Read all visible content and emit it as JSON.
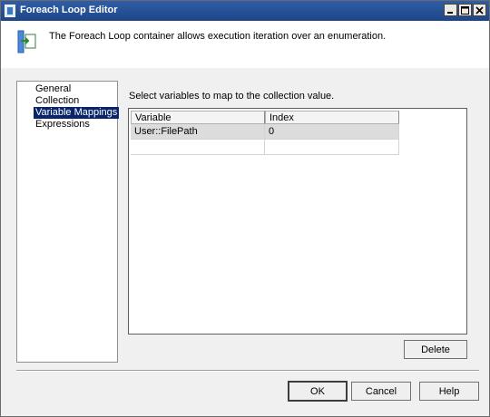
{
  "window": {
    "title": "Foreach Loop Editor",
    "description": "The Foreach Loop container allows execution iteration over an enumeration."
  },
  "sidebar": {
    "items": [
      {
        "label": "General",
        "selected": false
      },
      {
        "label": "Collection",
        "selected": false
      },
      {
        "label": "Variable Mappings",
        "selected": true
      },
      {
        "label": "Expressions",
        "selected": false
      }
    ]
  },
  "main": {
    "prompt": "Select variables to map to the collection value.",
    "columns": [
      "Variable",
      "Index"
    ],
    "rows": [
      {
        "variable": "User::FilePath",
        "index": "0"
      },
      {
        "variable": "",
        "index": ""
      }
    ],
    "delete_label": "Delete"
  },
  "footer": {
    "ok_label": "OK",
    "cancel_label": "Cancel",
    "help_label": "Help"
  },
  "colors": {
    "titlebar": "#1d4688",
    "selection": "#0a246a"
  }
}
